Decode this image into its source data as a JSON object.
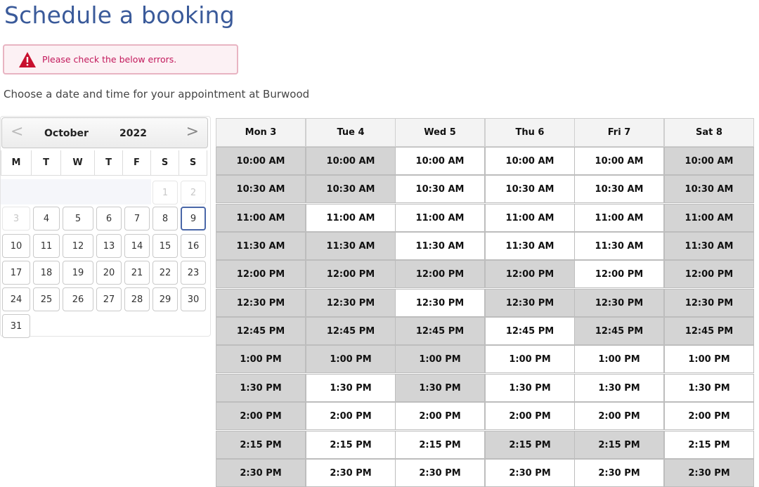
{
  "page": {
    "title": "Schedule a booking",
    "alert": "Please check the below errors.",
    "intro": "Choose a date and time for your appointment at Burwood"
  },
  "calendar": {
    "month": "October",
    "year": "2022",
    "prev": "<",
    "next": ">",
    "weekdays": [
      "M",
      "T",
      "W",
      "T",
      "F",
      "S",
      "S"
    ],
    "weeks": [
      [
        null,
        null,
        null,
        null,
        null,
        {
          "d": "1",
          "disabled": true
        },
        {
          "d": "2",
          "disabled": true
        }
      ],
      [
        {
          "d": "3",
          "disabled": true
        },
        {
          "d": "4"
        },
        {
          "d": "5"
        },
        {
          "d": "6"
        },
        {
          "d": "7"
        },
        {
          "d": "8"
        },
        {
          "d": "9",
          "selected": true
        }
      ],
      [
        {
          "d": "10"
        },
        {
          "d": "11"
        },
        {
          "d": "12"
        },
        {
          "d": "13"
        },
        {
          "d": "14"
        },
        {
          "d": "15"
        },
        {
          "d": "16"
        }
      ],
      [
        {
          "d": "17"
        },
        {
          "d": "18"
        },
        {
          "d": "19"
        },
        {
          "d": "20"
        },
        {
          "d": "21"
        },
        {
          "d": "22"
        },
        {
          "d": "23"
        }
      ],
      [
        {
          "d": "24"
        },
        {
          "d": "25"
        },
        {
          "d": "26"
        },
        {
          "d": "27"
        },
        {
          "d": "28"
        },
        {
          "d": "29"
        },
        {
          "d": "30"
        }
      ],
      [
        {
          "d": "31"
        },
        null,
        null,
        null,
        null,
        null,
        null
      ]
    ]
  },
  "schedule": {
    "days": [
      "Mon 3",
      "Tue 4",
      "Wed 5",
      "Thu 6",
      "Fri 7",
      "Sat 8"
    ],
    "times": [
      "10:00 AM",
      "10:30 AM",
      "11:00 AM",
      "11:30 AM",
      "12:00 PM",
      "12:30 PM",
      "12:45 PM",
      "1:00 PM",
      "1:30 PM",
      "2:00 PM",
      "2:15 PM",
      "2:30 PM"
    ],
    "available": [
      [
        false,
        false,
        true,
        true,
        true,
        false
      ],
      [
        false,
        false,
        true,
        true,
        true,
        false
      ],
      [
        false,
        true,
        true,
        true,
        true,
        false
      ],
      [
        false,
        false,
        true,
        true,
        true,
        false
      ],
      [
        false,
        false,
        false,
        false,
        true,
        false
      ],
      [
        false,
        false,
        true,
        false,
        false,
        false
      ],
      [
        false,
        false,
        false,
        true,
        false,
        false
      ],
      [
        false,
        false,
        false,
        true,
        true,
        true
      ],
      [
        false,
        true,
        false,
        true,
        true,
        true
      ],
      [
        false,
        true,
        true,
        true,
        true,
        true
      ],
      [
        false,
        true,
        true,
        false,
        false,
        true
      ],
      [
        false,
        true,
        true,
        true,
        true,
        false
      ]
    ]
  },
  "colors": {
    "title": "#3a5a9a",
    "alert_text": "#c2185b",
    "alert_icon": "#c8102e",
    "slot_unavailable": "#d4d4d4",
    "slot_available": "#ffffff"
  }
}
